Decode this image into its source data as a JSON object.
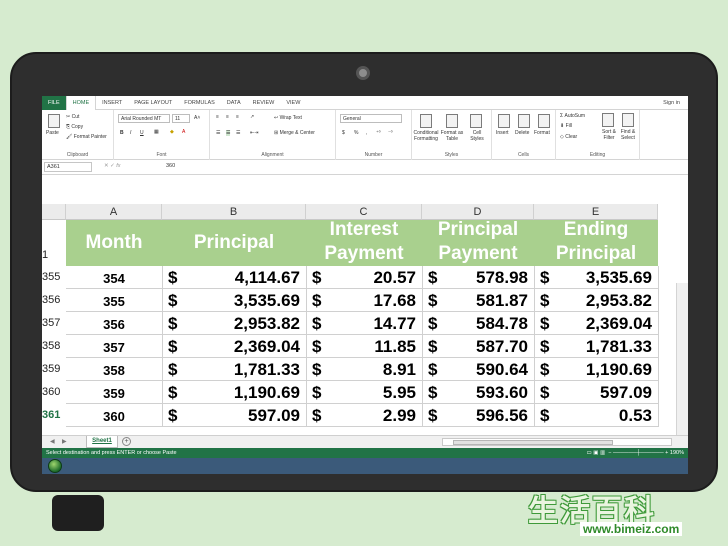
{
  "ribbon_tabs": [
    "FILE",
    "HOME",
    "INSERT",
    "PAGE LAYOUT",
    "FORMULAS",
    "DATA",
    "REVIEW",
    "VIEW"
  ],
  "sign_in": "Sign in",
  "clipboard": {
    "paste": "Paste",
    "cut": "Cut",
    "copy": "Copy",
    "format_painter": "Format Painter",
    "label": "Clipboard"
  },
  "font": {
    "name": "Arial Rounded MT",
    "size": "11",
    "bold": "B",
    "italic": "I",
    "underline": "U",
    "label": "Font"
  },
  "alignment": {
    "wrap": "Wrap Text",
    "merge": "Merge & Center",
    "label": "Alignment"
  },
  "number": {
    "format": "General",
    "currency": "$",
    "percent": "%",
    "comma": ",",
    "label": "Number"
  },
  "styles": {
    "conditional": "Conditional Formatting",
    "format_table": "Format as Table",
    "cell_styles": "Cell Styles",
    "label": "Styles"
  },
  "cells": {
    "insert": "Insert",
    "delete": "Delete",
    "format": "Format",
    "label": "Cells"
  },
  "editing": {
    "autosum": "AutoSum",
    "fill": "Fill",
    "clear": "Clear",
    "sort": "Sort & Filter",
    "find": "Find & Select",
    "label": "Editing"
  },
  "formula_bar": {
    "name_box": "A361",
    "fx": "fx",
    "value": "360"
  },
  "columns": [
    "A",
    "B",
    "C",
    "D",
    "E"
  ],
  "header_row_num": "1",
  "headers": {
    "a": "Month",
    "b": "Principal",
    "c1": "Interest",
    "c2": "Payment",
    "d1": "Principal",
    "d2": "Payment",
    "e1": "Ending",
    "e2": "Principal"
  },
  "rows": [
    {
      "n": "355",
      "a": "354",
      "b": "4,114.67",
      "c": "20.57",
      "d": "578.98",
      "e": "3,535.69"
    },
    {
      "n": "356",
      "a": "355",
      "b": "3,535.69",
      "c": "17.68",
      "d": "581.87",
      "e": "2,953.82"
    },
    {
      "n": "357",
      "a": "356",
      "b": "2,953.82",
      "c": "14.77",
      "d": "584.78",
      "e": "2,369.04"
    },
    {
      "n": "358",
      "a": "357",
      "b": "2,369.04",
      "c": "11.85",
      "d": "587.70",
      "e": "1,781.33"
    },
    {
      "n": "359",
      "a": "358",
      "b": "1,781.33",
      "c": "8.91",
      "d": "590.64",
      "e": "1,190.69"
    },
    {
      "n": "360",
      "a": "359",
      "b": "1,190.69",
      "c": "5.95",
      "d": "593.60",
      "e": "597.09"
    },
    {
      "n": "361",
      "a": "360",
      "b": "597.09",
      "c": "2.99",
      "d": "596.56",
      "e": "0.53"
    }
  ],
  "currency_symbol": "$",
  "sheet_tab": "Sheet1",
  "status_text": "Select destination and press ENTER or choose Paste",
  "zoom": "190%",
  "watermark": {
    "chars": "生活百科",
    "url": "www.bimeiz.com"
  },
  "colors": {
    "excel_green": "#217346",
    "header_fill": "#a9d08e",
    "selection_fill": "#bfbfbf"
  }
}
